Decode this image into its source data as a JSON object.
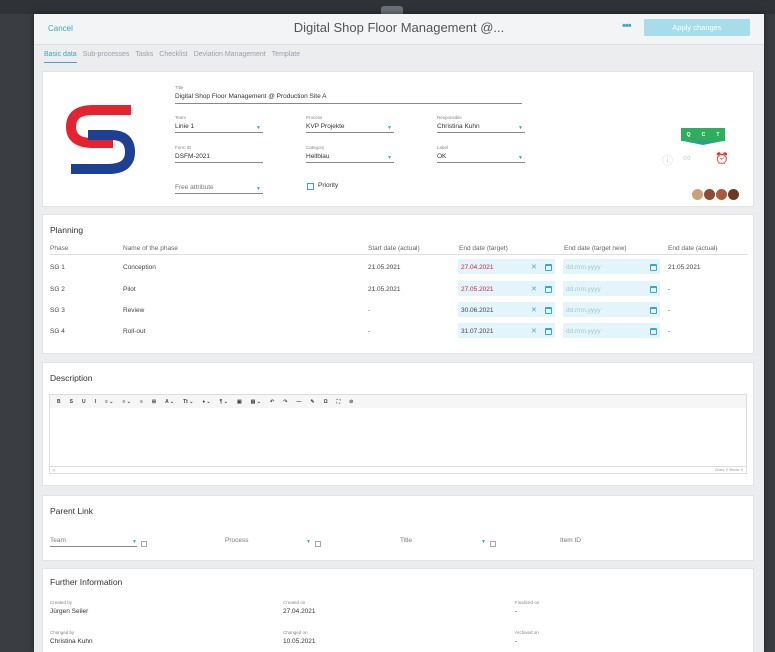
{
  "header": {
    "cancel": "Cancel",
    "title": "Digital Shop Floor Management @...",
    "more": "•••",
    "apply": "Apply changes"
  },
  "tabs": [
    "Basic data",
    "Sub-processes",
    "Tasks",
    "Checklist",
    "Deviation Management",
    "Template"
  ],
  "basic": {
    "title_label": "Title",
    "title_value": "Digital Shop Floor Management @ Production Site A",
    "team_label": "Team",
    "team_value": "Linie 1",
    "process_label": "Process",
    "process_value": "KVP Projekte",
    "responsible_label": "Responsible",
    "responsible_value": "Christina Kuhn",
    "formid_label": "Form ID",
    "formid_value": "DSFM-2021",
    "category_label": "Category",
    "category_value": "Hellblau",
    "labelf_label": "Label",
    "labelf_value": "OK",
    "free_attribute": "Free attribute",
    "priority": "Priority",
    "qct": [
      "Q",
      "C",
      "T"
    ],
    "avatar_colors": [
      "#c9a27a",
      "#8c4a2f",
      "#a55c3c",
      "#6b3a22"
    ],
    "brand_colors": {
      "red": "#e3232f",
      "blue": "#1d3f94"
    }
  },
  "planning": {
    "title": "Planning",
    "headers": [
      "Phase",
      "Name of the phase",
      "Start date (actual)",
      "End date (target)",
      "End date (target new)",
      "End date (actual)"
    ],
    "placeholder": "dd.mm.yyyy",
    "rows": [
      {
        "phase": "SG 1",
        "name": "Conception",
        "start": "21.05.2021",
        "target": "27.04.2021",
        "actual": "21.05.2021"
      },
      {
        "phase": "SG 2",
        "name": "Pilot",
        "start": "21.05.2021",
        "target": "27.05.2021",
        "actual": "-"
      },
      {
        "phase": "SG 3",
        "name": "Review",
        "start": "-",
        "target": "30.06.2021",
        "actual": "-"
      },
      {
        "phase": "SG 4",
        "name": "Roll-out",
        "start": "-",
        "target": "31.07.2021",
        "actual": "-"
      }
    ]
  },
  "description": {
    "title": "Description",
    "toolbar": [
      "B",
      "S",
      "U",
      "I",
      "≡ ⌄",
      "≡ ⌄",
      "≡",
      "⊞",
      "A ⌄",
      "Tt ⌄",
      "♦ ⌄",
      "¶ ⌄",
      "▣",
      "▤ ⌄",
      "↶",
      "↷",
      "—",
      "✎",
      "Ω",
      "⛶",
      "⊘"
    ],
    "status_left": "p",
    "status_right": "Chars: 0  Words: 0"
  },
  "parent": {
    "title": "Parent Link",
    "team": "Team",
    "process": "Process",
    "title_field": "Title",
    "item_id": "Item ID"
  },
  "further": {
    "title": "Further Information",
    "created_by_label": "Created by",
    "created_by": "Jürgen Seiler",
    "created_on_label": "Created on",
    "created_on": "27.04.2021",
    "finalized_label": "Finalized on",
    "finalized": "-",
    "changed_by_label": "Changed by",
    "changed_by": "Christina Kuhn",
    "changed_on_label": "Changed on",
    "changed_on": "10.05.2021",
    "archived_label": "Archived on",
    "archived": "-"
  }
}
